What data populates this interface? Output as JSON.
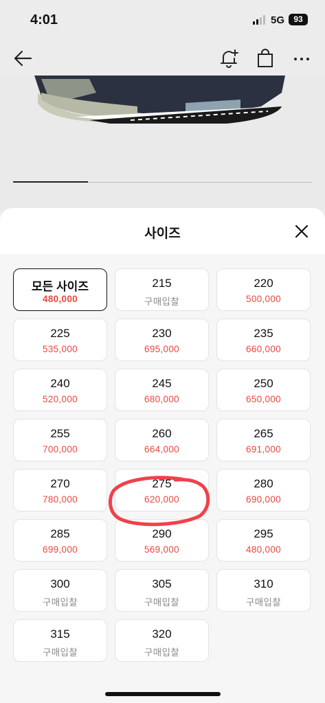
{
  "status": {
    "time": "4:01",
    "network": "5G",
    "battery": "93"
  },
  "nav": {
    "back_icon": "arrow-left-icon",
    "icons": [
      "bell-plus-icon",
      "shopping-bag-icon",
      "more-icon"
    ]
  },
  "gallery": {
    "progress": 0.25
  },
  "sheet": {
    "title": "사이즈",
    "sizes": [
      {
        "size": "모든 사이즈",
        "price": "480,000"
      },
      {
        "size": "215",
        "price": "구매입찰"
      },
      {
        "size": "220",
        "price": "500,000"
      },
      {
        "size": "225",
        "price": "535,000"
      },
      {
        "size": "230",
        "price": "695,000"
      },
      {
        "size": "235",
        "price": "660,000"
      },
      {
        "size": "240",
        "price": "520,000"
      },
      {
        "size": "245",
        "price": "680,000"
      },
      {
        "size": "250",
        "price": "650,000"
      },
      {
        "size": "255",
        "price": "700,000"
      },
      {
        "size": "260",
        "price": "664,000"
      },
      {
        "size": "265",
        "price": "691,000"
      },
      {
        "size": "270",
        "price": "780,000"
      },
      {
        "size": "275",
        "price": "620,000"
      },
      {
        "size": "280",
        "price": "690,000"
      },
      {
        "size": "285",
        "price": "699,000"
      },
      {
        "size": "290",
        "price": "569,000"
      },
      {
        "size": "295",
        "price": "480,000"
      },
      {
        "size": "300",
        "price": "구매입찰"
      },
      {
        "size": "305",
        "price": "구매입찰"
      },
      {
        "size": "310",
        "price": "구매입찰"
      },
      {
        "size": "315",
        "price": "구매입찰"
      },
      {
        "size": "320",
        "price": "구매입찰"
      }
    ]
  },
  "colors": {
    "price": "#e8483c",
    "bid": "#8a8a8a",
    "annotation": "#f0414a"
  }
}
